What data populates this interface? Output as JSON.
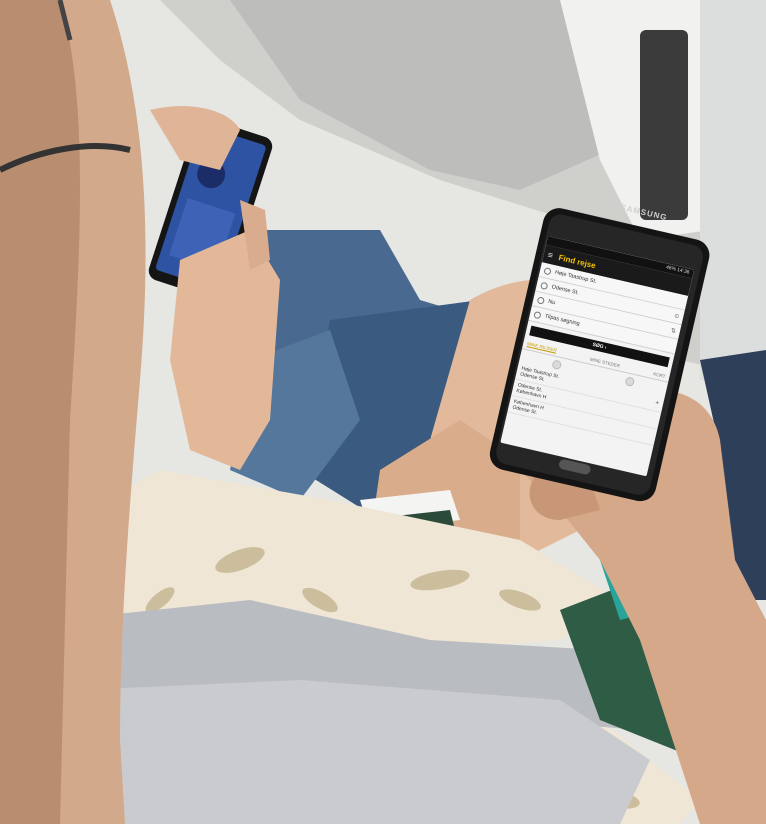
{
  "phone": {
    "brand": "SAMSUNG",
    "status_text": "46% 14:36",
    "app_title": "Find rejse",
    "fields": [
      {
        "icon": "location-icon",
        "text": "Høje Taastrup St.",
        "end": ""
      },
      {
        "icon": "location-icon",
        "text": "Odense St.",
        "end": "⊙"
      },
      {
        "icon": "clock-icon",
        "text": "Nu",
        "end": "⇅"
      },
      {
        "icon": "filter-icon",
        "text": "Tilpas søgning",
        "end": ""
      }
    ],
    "search_label": "SØG ›",
    "tabs": [
      "MINE REJSER",
      "MINE STEDER",
      "KORT"
    ],
    "trips": [
      {
        "from": "Høje Taastrup St.",
        "to": "Odense St.",
        "action": "+"
      },
      {
        "from": "Odense St.",
        "to": "København H",
        "action": ""
      },
      {
        "from": "København H",
        "to": "Odense St.",
        "action": ""
      }
    ]
  }
}
